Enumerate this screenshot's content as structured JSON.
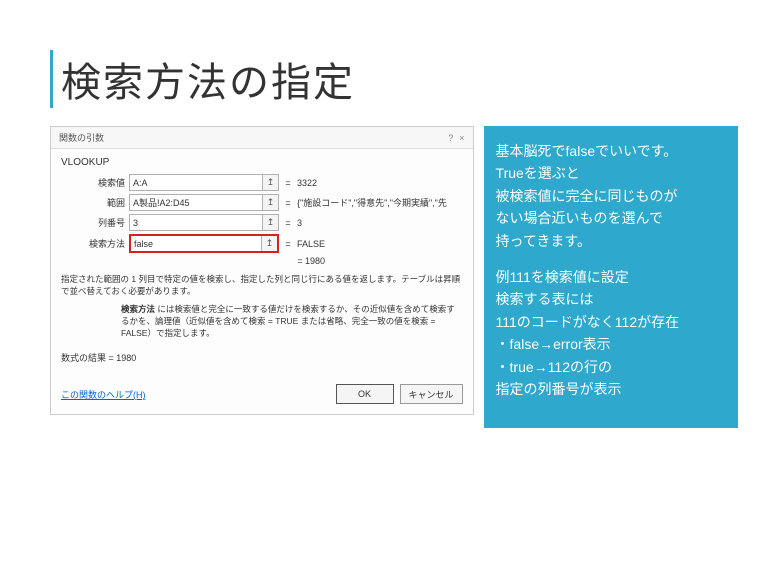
{
  "title": "検索方法の指定",
  "dialog": {
    "title": "関数の引数",
    "help_icon": "?",
    "close_icon": "×",
    "func_name": "VLOOKUP",
    "args": [
      {
        "label": "検索値",
        "value": "A:A",
        "result": "3322"
      },
      {
        "label": "範囲",
        "value": "A製品!A2:D45",
        "result": "{\"施設コード\",\"得意先\",\"今期実績\",\"先期…"
      },
      {
        "label": "列番号",
        "value": "3",
        "result": "3"
      },
      {
        "label": "検索方法",
        "value": "false",
        "result": "FALSE",
        "highlight": true
      }
    ],
    "overall_result": "1980",
    "description1": "指定された範囲の 1 列目で特定の値を検索し、指定した列と同じ行にある値を返します。テーブルは昇順で並べ替えておく必要があります。",
    "description2_label": "検索方法",
    "description2_text": "には検索値と完全に一致する値だけを検索するか、その近似値を含めて検索するかを、論理値（近似値を含めて検索 = TRUE または省略、完全一致の値を検索 = FALSE）で指定します。",
    "formula_result_label": "数式の結果 =",
    "formula_result_value": "1980",
    "help_link": "この関数のヘルプ(H)",
    "ok": "OK",
    "cancel": "キャンセル"
  },
  "side": {
    "p1": "基本脳死でfalseでいいです。\nTrueを選ぶと\n被検索値に完全に同じものが\nない場合近いものを選んで\n持ってきます。",
    "p2": "例111を検索値に設定\n検索する表には\n111のコードがなく112が存在\n・false→error表示\n・true→112の行の\n指定の列番号が表示"
  }
}
